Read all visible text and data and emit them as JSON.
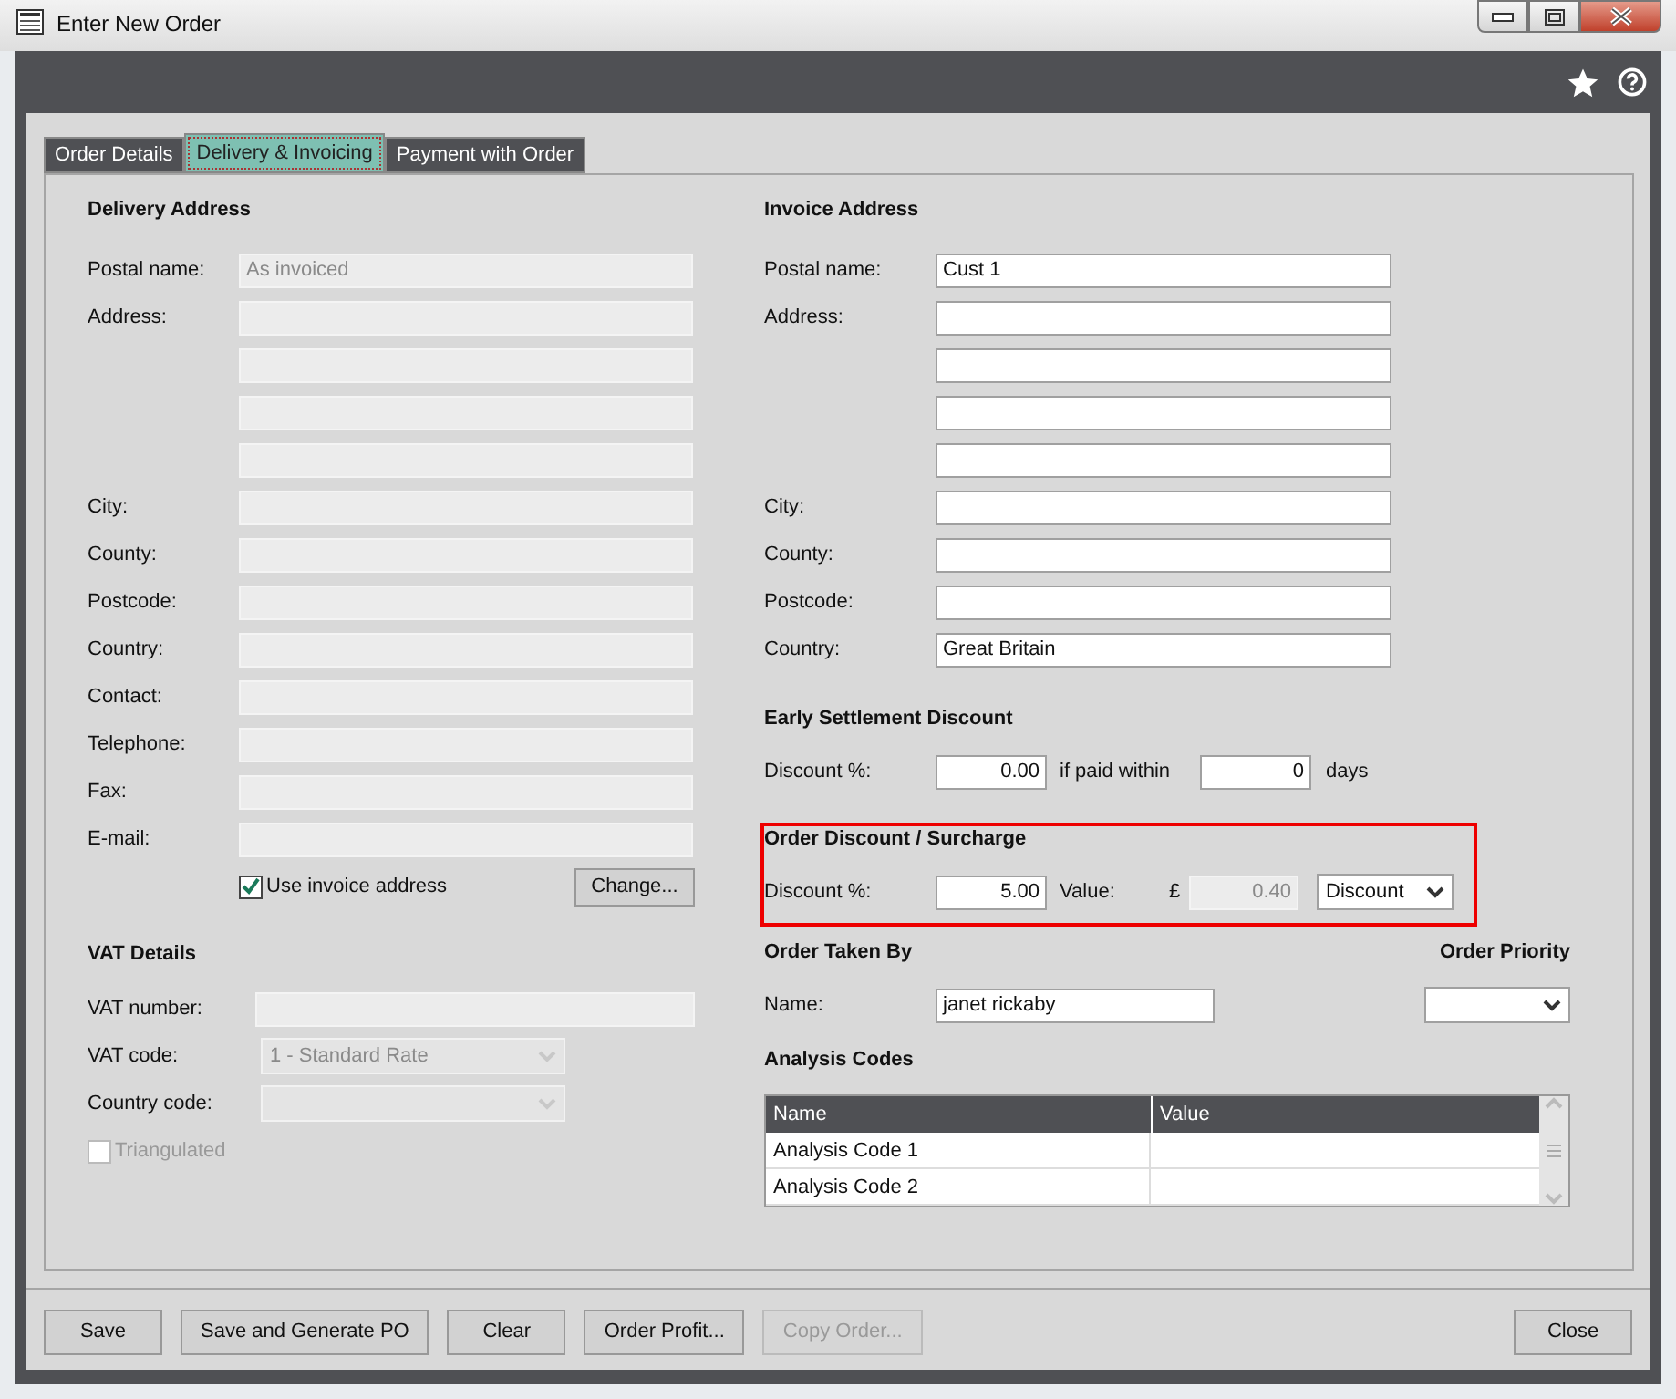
{
  "window": {
    "title": "Enter New Order"
  },
  "tabs": [
    {
      "label": "Order Details",
      "selected": false
    },
    {
      "label": "Delivery & Invoicing",
      "selected": true
    },
    {
      "label": "Payment with Order",
      "selected": false
    }
  ],
  "delivery_address": {
    "heading": "Delivery Address",
    "fields": [
      {
        "label": "Postal name:",
        "value": "As invoiced",
        "disabled": true
      },
      {
        "label": "Address:",
        "disabled": true
      },
      {
        "disabled": true
      },
      {
        "disabled": true
      },
      {
        "disabled": true
      },
      {
        "label": "City:",
        "disabled": true
      },
      {
        "label": "County:",
        "disabled": true
      },
      {
        "label": "Postcode:",
        "disabled": true
      },
      {
        "label": "Country:",
        "disabled": true
      },
      {
        "label": "Contact:",
        "disabled": true
      },
      {
        "label": "Telephone:",
        "disabled": true
      },
      {
        "label": "Fax:",
        "disabled": true
      },
      {
        "label": "E-mail:",
        "disabled": true
      }
    ],
    "use_invoice_address": {
      "label": "Use invoice address",
      "checked": true
    },
    "change_button": "Change..."
  },
  "vat_details": {
    "heading": "VAT Details",
    "vat_number": {
      "label": "VAT number:",
      "disabled": true
    },
    "vat_code": {
      "label": "VAT code:",
      "value": "1 - Standard Rate",
      "disabled": true
    },
    "country_code": {
      "label": "Country code:",
      "disabled": true
    },
    "triangulated": {
      "label": "Triangulated",
      "checked": false,
      "disabled": true
    }
  },
  "invoice_address": {
    "heading": "Invoice Address",
    "fields": [
      {
        "label": "Postal name:",
        "value": "Cust 1",
        "disabled": false
      },
      {
        "label": "Address:",
        "disabled": false
      },
      {
        "disabled": false
      },
      {
        "disabled": false
      },
      {
        "disabled": false
      },
      {
        "label": "City:",
        "disabled": false
      },
      {
        "label": "County:",
        "disabled": false
      },
      {
        "label": "Postcode:",
        "disabled": false
      },
      {
        "label": "Country:",
        "value": "Great Britain",
        "disabled": false
      }
    ]
  },
  "early_settlement": {
    "heading": "Early Settlement Discount",
    "discount_label": "Discount %:",
    "discount": "0.00",
    "within_label": "if paid within",
    "days": "0",
    "days_label": "days"
  },
  "order_discount": {
    "heading": "Order Discount / Surcharge",
    "highlighted": true,
    "discount_label": "Discount %:",
    "discount": "5.00",
    "value_label": "Value:",
    "currency": "£",
    "value": "0.40",
    "value_disabled": true,
    "type": "Discount"
  },
  "order_taken_by": {
    "heading": "Order Taken By",
    "name_label": "Name:",
    "name": "janet rickaby"
  },
  "order_priority": {
    "heading": "Order Priority"
  },
  "analysis_codes": {
    "heading": "Analysis Codes",
    "columns": [
      "Name",
      "Value"
    ],
    "rows": [
      {
        "name": "Analysis Code 1"
      },
      {
        "name": "Analysis Code 2"
      }
    ]
  },
  "buttons": [
    {
      "label": "Save",
      "disabled": false
    },
    {
      "label": "Save and Generate PO",
      "disabled": false
    },
    {
      "label": "Clear",
      "disabled": false
    },
    {
      "label": "Order Profit...",
      "disabled": false
    },
    {
      "label": "Copy Order...",
      "disabled": true
    }
  ],
  "right_buttons": [
    {
      "label": "Close",
      "disabled": false
    }
  ]
}
